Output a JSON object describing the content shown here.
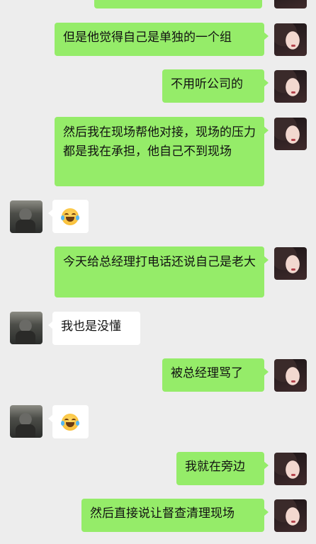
{
  "messages": [
    {
      "side": "out",
      "text": "但是他觉得自己是单独的一个组"
    },
    {
      "side": "out",
      "text": "不用听公司的"
    },
    {
      "side": "out",
      "text": "然后我在现场帮他对接，现场的压力都是我在承担，他自己不到现场"
    },
    {
      "side": "in",
      "emoji": "laughing-tears"
    },
    {
      "side": "out",
      "text": "今天给总经理打电话还说自己是老大"
    },
    {
      "side": "in",
      "text": "我也是没懂"
    },
    {
      "side": "out",
      "text": "被总经理骂了"
    },
    {
      "side": "in",
      "emoji": "laughing-tears"
    },
    {
      "side": "out",
      "text": "我就在旁边"
    },
    {
      "side": "out",
      "text": "然后直接说让督查清理现场"
    }
  ],
  "colors": {
    "background": "#ededed",
    "outgoing_bubble": "#95ec69",
    "incoming_bubble": "#ffffff"
  }
}
